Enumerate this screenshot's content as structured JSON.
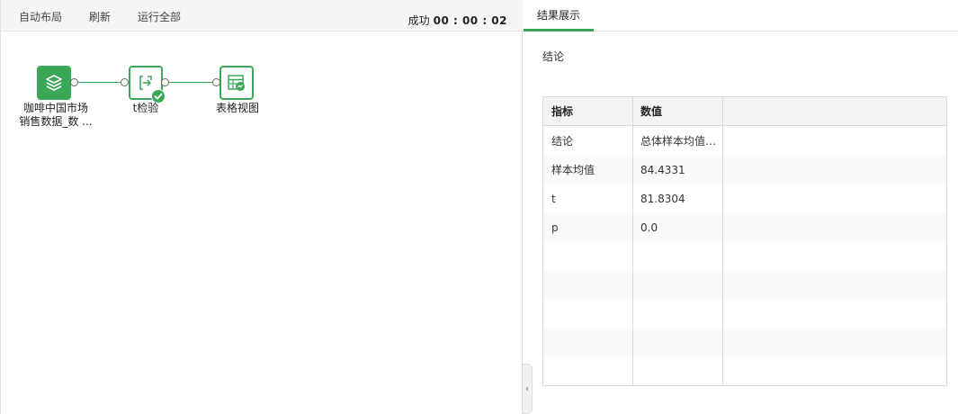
{
  "toolbar": {
    "auto_layout": "自动布局",
    "refresh": "刷新",
    "run_all": "运行全部",
    "status_label": "成功",
    "status_time": "00 : 00 : 02"
  },
  "workflow": {
    "nodes": [
      {
        "label_line1": "咖啡中国市场",
        "label_line2": "销售数据_数 ...",
        "icon": "layers-icon"
      },
      {
        "label_line1": "t检验",
        "icon": "import-arrow-icon",
        "status": "success"
      },
      {
        "label_line1": "表格视图",
        "icon": "table-view-icon"
      }
    ]
  },
  "result": {
    "tab_label": "结果展示",
    "conclusion_label": "结论",
    "table": {
      "headers": [
        "指标",
        "数值"
      ],
      "rows": [
        [
          "结论",
          "总体样本均值…"
        ],
        [
          "样本均值",
          "84.4331"
        ],
        [
          "t",
          "81.8304"
        ],
        [
          "p",
          "0.0"
        ]
      ]
    }
  },
  "colors": {
    "accent": "#3aa857",
    "toolbar_bg": "#f5f5f5",
    "table_header_bg": "#f3f3f3"
  }
}
